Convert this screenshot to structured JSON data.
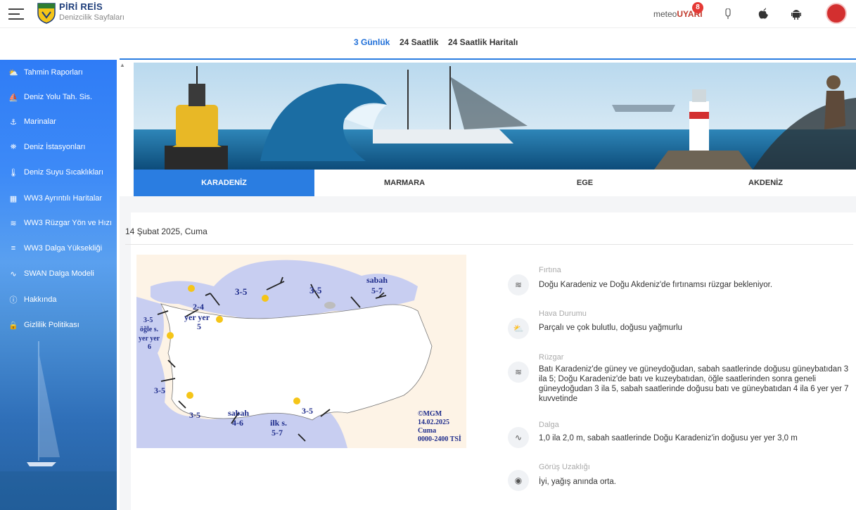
{
  "header": {
    "brand_title": "PİRİ REİS",
    "brand_subtitle": "Denizcilik Sayfaları",
    "meteo_prefix": "meteo",
    "meteo_suffix": "UYARI",
    "meteo_badge": "8",
    "icons": [
      "microphone-icon",
      "apple-icon",
      "android-icon",
      "mgm-logo"
    ]
  },
  "top_tabs": [
    {
      "label": "3 Günlük",
      "active": true
    },
    {
      "label": "24 Saatlik",
      "active": false
    },
    {
      "label": "24 Saatlik Haritalı",
      "active": false
    }
  ],
  "sidebar": {
    "items": [
      {
        "label": "Tahmin Raporları",
        "icon": "weather-icon"
      },
      {
        "label": "Deniz Yolu Tah. Sis.",
        "icon": "ship-route-icon"
      },
      {
        "label": "Marinalar",
        "icon": "marina-icon"
      },
      {
        "label": "Deniz İstasyonları",
        "icon": "station-icon"
      },
      {
        "label": "Deniz Suyu Sıcaklıkları",
        "icon": "thermometer-icon"
      },
      {
        "label": "WW3 Ayrıntılı Haritalar",
        "icon": "map-icon"
      },
      {
        "label": "WW3 Rüzgar Yön ve Hızı",
        "icon": "wind-icon"
      },
      {
        "label": "WW3 Dalga Yüksekliği",
        "icon": "wave-height-icon"
      },
      {
        "label": "SWAN Dalga Modeli",
        "icon": "wave-model-icon"
      },
      {
        "label": "Hakkında",
        "icon": "help-icon"
      },
      {
        "label": "Gizlilik Politikası",
        "icon": "lock-icon"
      }
    ]
  },
  "region_tabs": [
    {
      "label": "KARADENİZ",
      "active": true
    },
    {
      "label": "MARMARA",
      "active": false
    },
    {
      "label": "EGE",
      "active": false
    },
    {
      "label": "AKDENİZ",
      "active": false
    }
  ],
  "forecast": {
    "date": "14 Şubat 2025, Cuma",
    "map_labels": {
      "copyright": "©MGM",
      "date": "14.02.2025",
      "day": "Cuma",
      "hours": "0000-2400 TSİ",
      "w1": "3-5",
      "w2": "3-5",
      "w3": "sabah",
      "w4": "5-7",
      "w5": "2-4",
      "w6": "yer yer",
      "w7": "5",
      "w8": "3-5",
      "w9": "öğle s.",
      "w10": "yer yer",
      "w11": "6",
      "w12": "3-5",
      "w13": "3-5",
      "w14": "sabah",
      "w15": "4-6",
      "w16": "ilk s.",
      "w17": "5-7",
      "w18": "3-5"
    },
    "items": [
      {
        "title": "Fırtına",
        "icon": "wind-icon",
        "text": "Doğu Karadeniz ve Doğu Akdeniz'de fırtınamsı rüzgar bekleniyor."
      },
      {
        "title": "Hava Durumu",
        "icon": "weather-icon",
        "text": "Parçalı ve çok bulutlu, doğusu yağmurlu"
      },
      {
        "title": "Rüzgar",
        "icon": "wind-icon",
        "text": "Batı Karadeniz'de güney ve güneydoğudan, sabah saatlerinde doğusu güneybatıdan 3 ila 5; Doğu Karadeniz'de batı ve kuzeybatıdan, öğle saatlerinden sonra geneli güneydoğudan 3 ila 5, sabah saatlerinde doğusu batı ve güneybatıdan 4 ila 6 yer yer 7 kuvvetinde"
      },
      {
        "title": "Dalga",
        "icon": "wave-icon",
        "text": "1,0 ila 2,0 m, sabah saatlerinde Doğu Karadeniz'in doğusu yer yer 3,0 m"
      },
      {
        "title": "Görüş Uzaklığı",
        "icon": "eye-icon",
        "text": "İyi, yağış anında orta."
      }
    ]
  }
}
